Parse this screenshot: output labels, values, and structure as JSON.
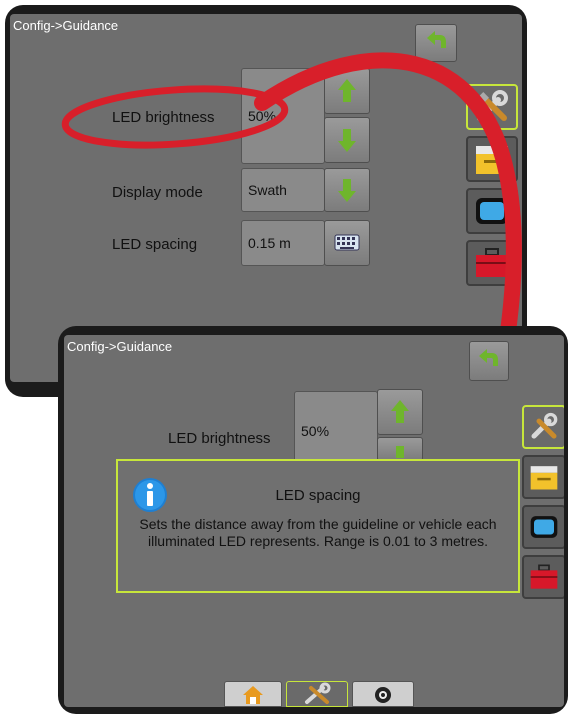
{
  "back": {
    "title": "Config->Guidance",
    "led_brightness": {
      "label": "LED brightness",
      "value": "50%"
    },
    "display_mode": {
      "label": "Display mode",
      "value": "Swath"
    },
    "led_spacing": {
      "label": "LED spacing",
      "value": "0.15 m"
    }
  },
  "front": {
    "title": "Config->Guidance",
    "led_brightness": {
      "label": "LED brightness",
      "value": "50%"
    },
    "info_popup": {
      "title": "LED spacing",
      "body": "Sets the distance away from the guideline or vehicle each illuminated LED represents. Range is 0.01 to 3 metres."
    }
  },
  "icons": {
    "back": "back-arrow-icon",
    "tools": "tools-icon",
    "console": "console-icon",
    "display": "display-icon",
    "toolbox": "toolbox-icon",
    "home": "home-icon",
    "camera": "camera-icon",
    "up": "up-arrow-icon",
    "down": "down-arrow-icon",
    "keyboard": "keyboard-icon",
    "info": "info-icon"
  },
  "colors": {
    "accent": "#c7e63b",
    "annotation": "#d81f2a",
    "arrow_green": "#6fb52c"
  }
}
